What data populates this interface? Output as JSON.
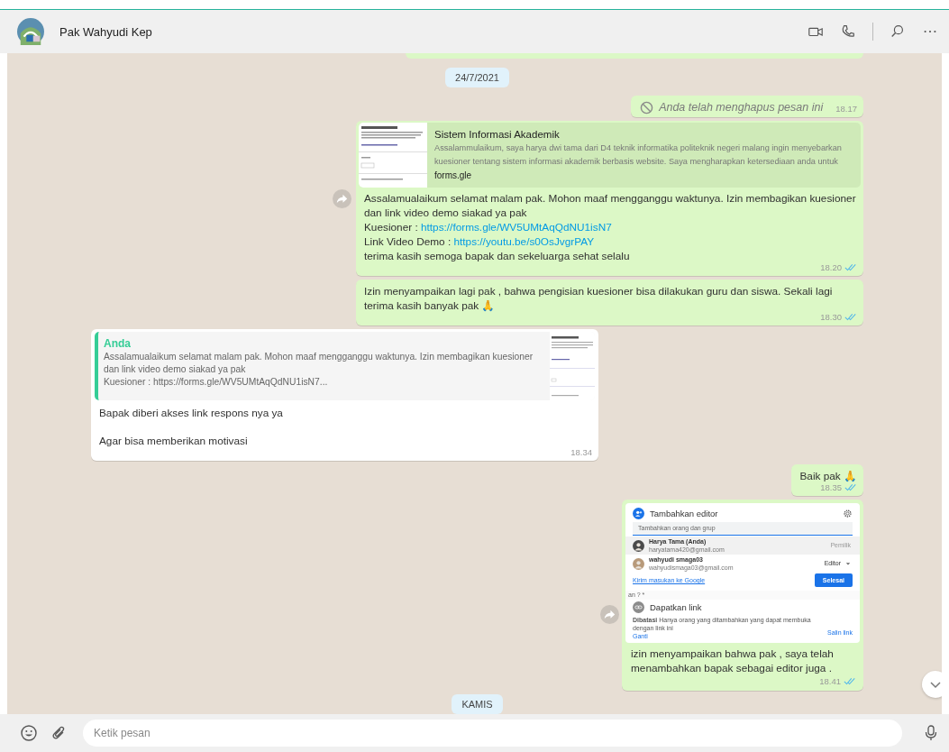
{
  "header": {
    "contact_name": "Pak Wahyudi Kep"
  },
  "messages": [
    {
      "kind": "partial"
    },
    {
      "kind": "date",
      "text": "24/7/2021"
    },
    {
      "kind": "deleted",
      "text": "Anda telah menghapus pesan ini",
      "time": "18.17"
    },
    {
      "kind": "link_preview",
      "preview": {
        "title": "Sistem Informasi Akademik",
        "description": "Assalammulaikum, saya harya dwi tama dari D4 teknik informatika politeknik negeri malang ingin menyebarkan kuesioner tentang sistem informasi akademik berbasis website. Saya mengharapkan ketersediaan anda untuk",
        "domain": "forms.gle"
      },
      "body": [
        {
          "text": "Assalamualaikum selamat malam pak. Mohon maaf mengganggu waktunya. Izin membagikan kuesioner dan link video demo siakad ya pak"
        },
        {
          "text": "Kuesioner : ",
          "link": "https://forms.gle/WV5UMtAqQdNU1isN7"
        },
        {
          "text": "Link Video Demo : ",
          "link": "https://youtu.be/s0OsJvgrPAY"
        },
        {
          "text": "terima kasih semoga bapak dan sekeluarga sehat selalu"
        }
      ],
      "time": "18.20",
      "read": true
    },
    {
      "kind": "text",
      "outgoing": true,
      "body": [
        {
          "text": "Izin menyampaikan lagi pak , bahwa pengisian kuesioner bisa dilakukan guru dan siswa. Sekali lagi terima kasih banyak pak 🙏"
        }
      ],
      "time": "18.30",
      "read": true
    },
    {
      "kind": "reply",
      "quote": {
        "author": "Anda",
        "lines": [
          "Assalamualaikum selamat malam pak. Mohon maaf mengganggu waktunya. Izin membagikan kuesioner dan link video demo siakad ya pak",
          "Kuesioner : https://forms.gle/WV5UMtAqQdNU1isN7..."
        ]
      },
      "body": [
        {
          "text": "Bapak diberi akses link respons nya ya"
        },
        {
          "text": "Agar bisa memberikan motivasi"
        }
      ],
      "time": "18.34"
    },
    {
      "kind": "text",
      "outgoing": true,
      "body": [
        {
          "text": "Baik pak 🙏"
        }
      ],
      "time": "18.35",
      "read": true
    },
    {
      "kind": "screenshot",
      "dialog": {
        "title": "Tambahkan editor",
        "input_placeholder": "Tambahkan orang dan grup",
        "people": [
          {
            "name": "Harya Tama (Anda)",
            "email": "haryatama420@gmail.com",
            "role": "Pemilik",
            "dropdown": false,
            "highlighted": true
          },
          {
            "name": "wahyudi smaga03",
            "email": "wahyudismaga03@gmail.com",
            "role": "Editor",
            "dropdown": true,
            "highlighted": false
          }
        ],
        "feedback_link": "Kirim masukan ke Google",
        "done_button": "Selesai",
        "fragment": "an ? *",
        "link_title": "Dapatkan link",
        "access_label": "Dibatasi",
        "access_text": "Hanya orang yang ditambahkan yang dapat membuka dengan link ini",
        "change_link": "Ganti",
        "copy_link": "Salin link"
      },
      "body": [
        {
          "text": "izin menyampaikan bahwa pak , saya telah menambahkan bapak sebagai editor juga ."
        }
      ],
      "time": "18.41",
      "read": true
    },
    {
      "kind": "date",
      "text": "KAMIS"
    }
  ],
  "composer": {
    "placeholder": "Ketik pesan"
  }
}
